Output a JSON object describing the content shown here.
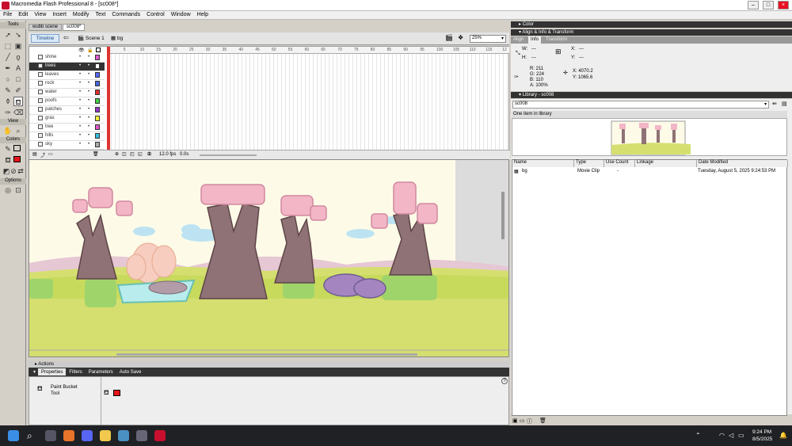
{
  "window": {
    "title": "Macromedia Flash Professional 8 - [sc008*]"
  },
  "menu": [
    "File",
    "Edit",
    "View",
    "Insert",
    "Modify",
    "Text",
    "Commands",
    "Control",
    "Window",
    "Help"
  ],
  "tools": {
    "header": "Tools",
    "view": "View",
    "colors": "Colors",
    "options": "Options",
    "stroke_color": "#000000",
    "fill_color": "#e8141b"
  },
  "doc_tabs": [
    "wubb scene",
    "sc008*"
  ],
  "edit_bar": {
    "timeline_label": "Timeline",
    "scene": "Scene 1",
    "symbol": "bg",
    "zoom": "25%"
  },
  "timeline": {
    "layers": [
      {
        "name": "shine",
        "color": "#e05ad0"
      },
      {
        "name": "trees",
        "color": "#ffffff",
        "selected": true
      },
      {
        "name": "leaves",
        "color": "#5566ff"
      },
      {
        "name": "rock",
        "color": "#4466dd"
      },
      {
        "name": "water",
        "color": "#e03030"
      },
      {
        "name": "poofs",
        "color": "#44cc44"
      },
      {
        "name": "patches",
        "color": "#9933cc"
      },
      {
        "name": "gras",
        "color": "#ffee33"
      },
      {
        "name": "tree",
        "color": "#e055d0"
      },
      {
        "name": "hills",
        "color": "#33bbdd"
      },
      {
        "name": "sky",
        "color": "#aaaaaa"
      }
    ],
    "ruler": [
      "1",
      "5",
      "10",
      "15",
      "20",
      "25",
      "30",
      "35",
      "40",
      "45",
      "50",
      "55",
      "60",
      "65",
      "70",
      "75",
      "80",
      "85",
      "90",
      "95",
      "100",
      "105",
      "110",
      "115",
      "12"
    ],
    "frame": "1",
    "fps": "12.0 fps",
    "time": "0.0s"
  },
  "actions_label": "Actions",
  "properties": {
    "tabs": [
      "Properties",
      "Filters",
      "Parameters",
      "Auto Save"
    ],
    "tool_name": "Paint Bucket\nTool",
    "help": "?"
  },
  "right_panel": {
    "color_header": "Color",
    "align_header": "Align & Info & Transform",
    "align_tabs": [
      "Align",
      "Info",
      "Transform"
    ],
    "info": {
      "w": "W:",
      "h": "H:",
      "x": "X:",
      "y": "Y:",
      "w_val": "---",
      "h_val": "---",
      "x_val": "---",
      "y_val": "---",
      "r": "R: 211",
      "g": "G: 224",
      "b": "B: 110",
      "a": "A: 100%",
      "cx": "X: 4070.2",
      "cy": "Y: 1065.6"
    },
    "library_header": "Library - sc008",
    "library_doc": "sc008",
    "library_count": "One item in library",
    "columns": [
      "Name",
      "Type",
      "Use Count",
      "Linkage",
      "Date Modified"
    ],
    "rows": [
      {
        "name": "bg",
        "type": "Movie Clip",
        "use_count": "-",
        "linkage": "",
        "date": "Tuesday, August 5, 2025  9:24:53 PM"
      }
    ]
  },
  "taskbar": {
    "time": "9:24 PM",
    "date": "8/5/2025"
  }
}
